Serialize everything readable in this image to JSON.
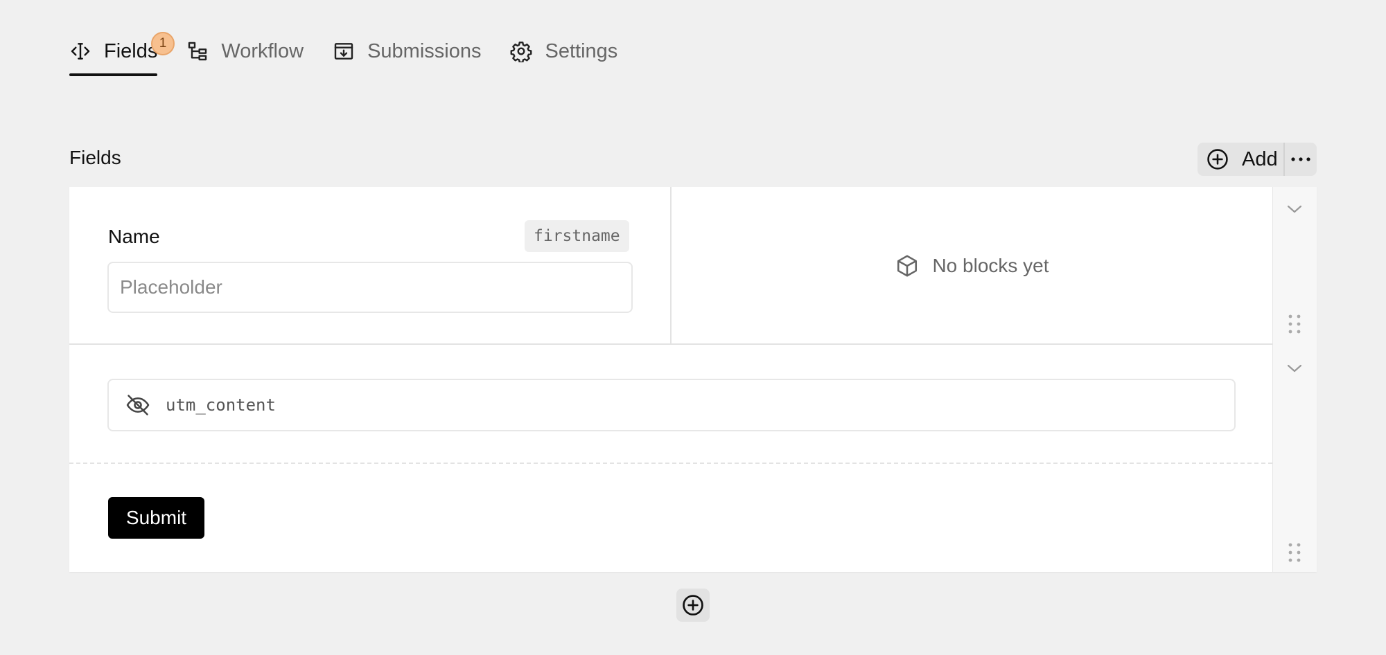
{
  "tabs": [
    {
      "label": "Fields",
      "icon": "code-cursor-icon",
      "active": true,
      "badge": "1"
    },
    {
      "label": "Workflow",
      "icon": "workflow-icon",
      "active": false
    },
    {
      "label": "Submissions",
      "icon": "inbox-download-icon",
      "active": false
    },
    {
      "label": "Settings",
      "icon": "gear-icon",
      "active": false
    }
  ],
  "section": {
    "title": "Fields",
    "add_label": "Add",
    "more_icon": "more-horizontal-icon"
  },
  "fields": {
    "name_field": {
      "label": "Name",
      "key": "firstname",
      "placeholder": "Placeholder",
      "value": ""
    },
    "blocks_empty_text": "No blocks yet",
    "hidden_field": {
      "icon": "eye-off-icon",
      "key": "utm_content"
    },
    "submit_label": "Submit"
  },
  "colors": {
    "background": "#f0f0f0",
    "badge": "#f7c08f",
    "submit": "#000000"
  }
}
